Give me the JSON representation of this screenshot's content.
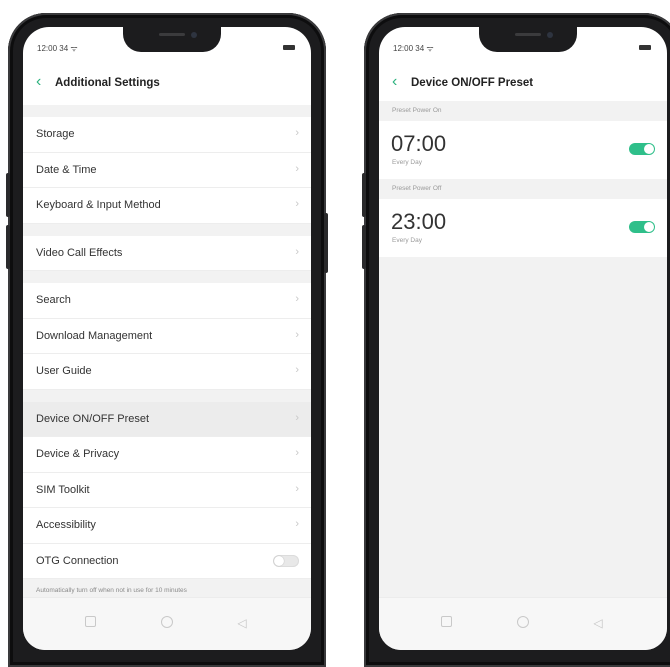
{
  "left_phone": {
    "status_time": "12:00 34 ᯤ",
    "title": "Additional Settings",
    "groups": [
      [
        {
          "label": "Storage"
        },
        {
          "label": "Date & Time"
        },
        {
          "label": "Keyboard & Input Method"
        }
      ],
      [
        {
          "label": "Video Call Effects"
        }
      ],
      [
        {
          "label": "Search"
        },
        {
          "label": "Download Management"
        },
        {
          "label": "User Guide"
        }
      ],
      [
        {
          "label": "Device ON/OFF Preset",
          "active": true
        },
        {
          "label": "Device & Privacy"
        },
        {
          "label": "SIM Toolkit"
        },
        {
          "label": "Accessibility"
        },
        {
          "label": "OTG Connection",
          "toggle": false
        }
      ]
    ],
    "otg_hint": "Automatically turn off when not in use for 10 minutes"
  },
  "right_phone": {
    "status_time": "12:00 34 ᯤ",
    "title": "Device ON/OFF Preset",
    "presets": [
      {
        "header": "Preset Power On",
        "time": "07:00",
        "repeat": "Every Day",
        "enabled": true
      },
      {
        "header": "Preset Power Off",
        "time": "23:00",
        "repeat": "Every Day",
        "enabled": true
      }
    ]
  },
  "icons": {
    "back": "chevron-left-icon",
    "chevron": "chevron-right-icon",
    "nav": [
      "square-icon",
      "circle-icon",
      "back-triangle-icon"
    ]
  },
  "colors": {
    "accent": "#2fbf8a"
  }
}
